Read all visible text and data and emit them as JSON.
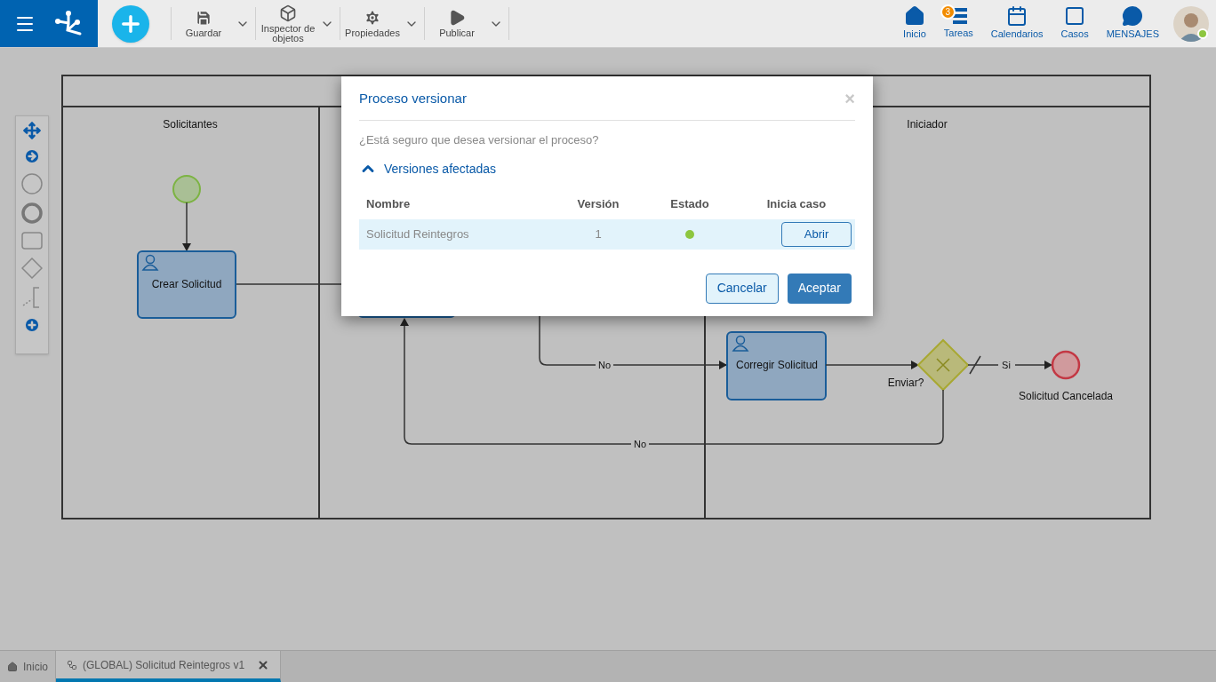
{
  "toolbar": {
    "buttons": [
      {
        "kind": "save",
        "label": "Guardar"
      },
      {
        "kind": "inspect",
        "label": "Inspector de objetos"
      },
      {
        "kind": "props",
        "label": "Propiedades"
      },
      {
        "kind": "publish",
        "label": "Publicar"
      }
    ]
  },
  "nav": [
    {
      "kind": "home",
      "label": "Inicio"
    },
    {
      "kind": "tasks",
      "label": "Tareas",
      "badge": "3"
    },
    {
      "kind": "calendar",
      "label": "Calendarios"
    },
    {
      "kind": "cases",
      "label": "Casos"
    },
    {
      "kind": "messages",
      "label": "MENSAJES"
    }
  ],
  "user": {
    "online": true
  },
  "diagram": {
    "lanes": [
      "Solicitantes",
      "Iniciador"
    ],
    "tasks": [
      "Crear Solicitud",
      "Corregir Solicitud"
    ],
    "gateway": "Enviar?",
    "end_event": "Solicitud Cancelada",
    "flow_labels": [
      "No",
      "Si",
      "No"
    ]
  },
  "dialog": {
    "title": "Proceso versionar",
    "close": "×",
    "question": "¿Está seguro que desea versionar el proceso?",
    "section": {
      "label": "Versiones afectadas",
      "expanded": true
    },
    "columns": [
      "Nombre",
      "Versión",
      "Estado",
      "Inicia caso"
    ],
    "rows": [
      {
        "name": "Solicitud Reintegros",
        "version": "1",
        "color": "#8dc63f",
        "action": "Abrir"
      }
    ],
    "buttons": [
      {
        "kind": "secondary",
        "label": "Cancelar"
      },
      {
        "kind": "primary",
        "label": "Aceptar"
      }
    ]
  },
  "tabs": [
    {
      "kind": "home",
      "label": "Inicio",
      "selected": false
    },
    {
      "kind": "process",
      "label": "(GLOBAL) Solicitud Reintegros v1",
      "selected": true,
      "closable": true
    }
  ]
}
